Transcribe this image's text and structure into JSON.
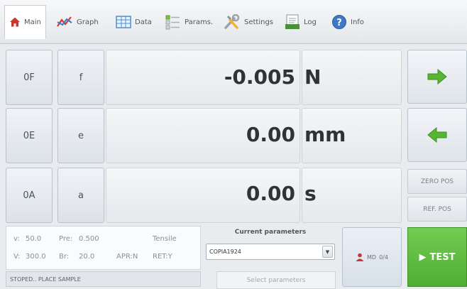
{
  "tabs": [
    {
      "label": "Main",
      "icon": "home-icon",
      "active": true
    },
    {
      "label": "Graph",
      "icon": "graph-icon",
      "active": false
    },
    {
      "label": "Data",
      "icon": "table-icon",
      "active": false
    },
    {
      "label": "Params.",
      "icon": "list-icon",
      "active": false
    },
    {
      "label": "Settings",
      "icon": "tools-icon",
      "active": false
    },
    {
      "label": "Log",
      "icon": "log-icon",
      "active": false
    },
    {
      "label": "Info",
      "icon": "info-icon",
      "active": false
    }
  ],
  "readouts": [
    {
      "zero_label": "0F",
      "symbol": "f",
      "value": "-0.005",
      "unit": "N"
    },
    {
      "zero_label": "0E",
      "symbol": "e",
      "value": "0.00",
      "unit": "mm"
    },
    {
      "zero_label": "0A",
      "symbol": "a",
      "value": "0.00",
      "unit": "s"
    }
  ],
  "side_buttons": {
    "forward_icon": "arrow-right-icon",
    "back_icon": "arrow-left-icon",
    "zero_pos": "ZERO POS",
    "ref_pos": "REF. POS"
  },
  "status": {
    "row1": {
      "v_label": "v:",
      "v_value": "50.0",
      "pre_label": "Pre:",
      "pre_value": "0.500",
      "mode": "Tensile"
    },
    "row2": {
      "v_label": "V:",
      "v_value": "300.0",
      "br_label": "Br:",
      "br_value": "20.0",
      "apr": "APR:N",
      "ret": "RET:Y"
    },
    "message": "STOPED.. PLACE SAMPLE"
  },
  "params": {
    "title": "Current parameters",
    "selected": "COPIA1924",
    "select_button": "Select parameters"
  },
  "md_button": {
    "label": "MD",
    "count": "0/4"
  },
  "test_button": {
    "label": "TEST"
  },
  "colors": {
    "accent_green": "#5cb83c",
    "arrow_green": "#57b631",
    "home_red": "#c8372d"
  }
}
